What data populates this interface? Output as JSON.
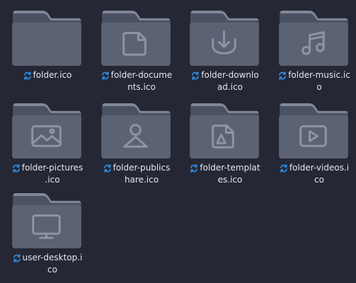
{
  "colors": {
    "background": "#252734",
    "folder_front": "#5b6274",
    "folder_back": "#4a5163",
    "folder_tab": "#89909f",
    "folder_glyph": "#8c94a5",
    "label_text": "#e4e6ee",
    "sync_icon": "#2f8fe8"
  },
  "files": [
    {
      "line1": "folder.ico",
      "line2": "",
      "glyph": "none"
    },
    {
      "line1": "folder-docume",
      "line2": "nts.ico",
      "glyph": "document-icon"
    },
    {
      "line1": "folder-downlo",
      "line2": "ad.ico",
      "glyph": "download-icon"
    },
    {
      "line1": "folder-music.ic",
      "line2": "o",
      "glyph": "music-note-icon"
    },
    {
      "line1": "folder-pictures",
      "line2": ".ico",
      "glyph": "picture-icon"
    },
    {
      "line1": "folder-publics",
      "line2": "hare.ico",
      "glyph": "person-icon"
    },
    {
      "line1": "folder-templat",
      "line2": "es.ico",
      "glyph": "template-icon"
    },
    {
      "line1": "folder-videos.i",
      "line2": "co",
      "glyph": "video-play-icon"
    },
    {
      "line1": "user-desktop.i",
      "line2": "co",
      "glyph": "monitor-icon"
    }
  ]
}
